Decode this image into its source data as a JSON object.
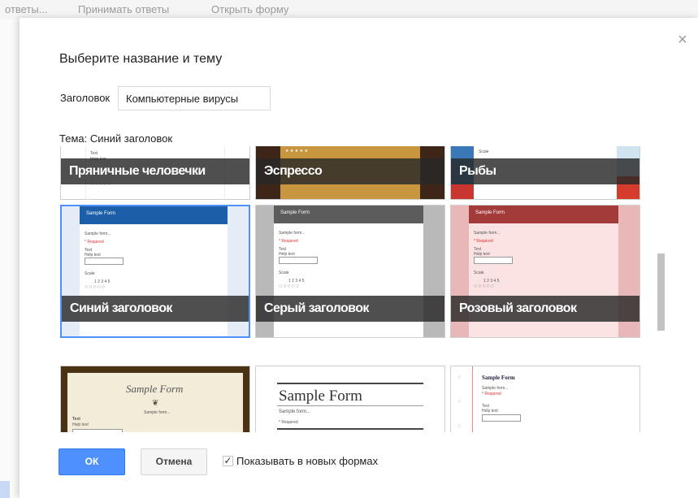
{
  "background": {
    "toolbar": [
      {
        "label": "ответы..."
      },
      {
        "label": "Принимать ответы"
      },
      {
        "label": "Открыть форму"
      }
    ]
  },
  "dialog": {
    "title": "Выберите название и тему",
    "header_label": "Заголовок",
    "header_value": "Компьютерные вирусы",
    "theme_label": "Тема: Синий заголовок",
    "close_symbol": "×",
    "themes": [
      {
        "name": "Пряничные человечки"
      },
      {
        "name": "Эспрессо"
      },
      {
        "name": "Рыбы"
      },
      {
        "name": "Синий заголовок",
        "selected": true
      },
      {
        "name": "Серый заголовок"
      },
      {
        "name": "Розовый заголовок"
      },
      {
        "name": ""
      },
      {
        "name": ""
      },
      {
        "name": ""
      }
    ],
    "preview": {
      "sample_form": "Sample Form",
      "sample_form_desc": "Sample form...",
      "required": "* Required",
      "text": "Text",
      "help_text": "Help text",
      "scale": "Scale",
      "scale_numbers": "1 2 3 4 5"
    },
    "ok_label": "ОК",
    "cancel_label": "Отмена",
    "show_in_new_label": "Показывать в новых формах",
    "show_in_new_checked": true
  },
  "colors": {
    "accent": "#4d90fe",
    "blue_header": "#1c5fa8",
    "gray_header": "#5c5c5c",
    "pink_header": "#a33b3b"
  }
}
